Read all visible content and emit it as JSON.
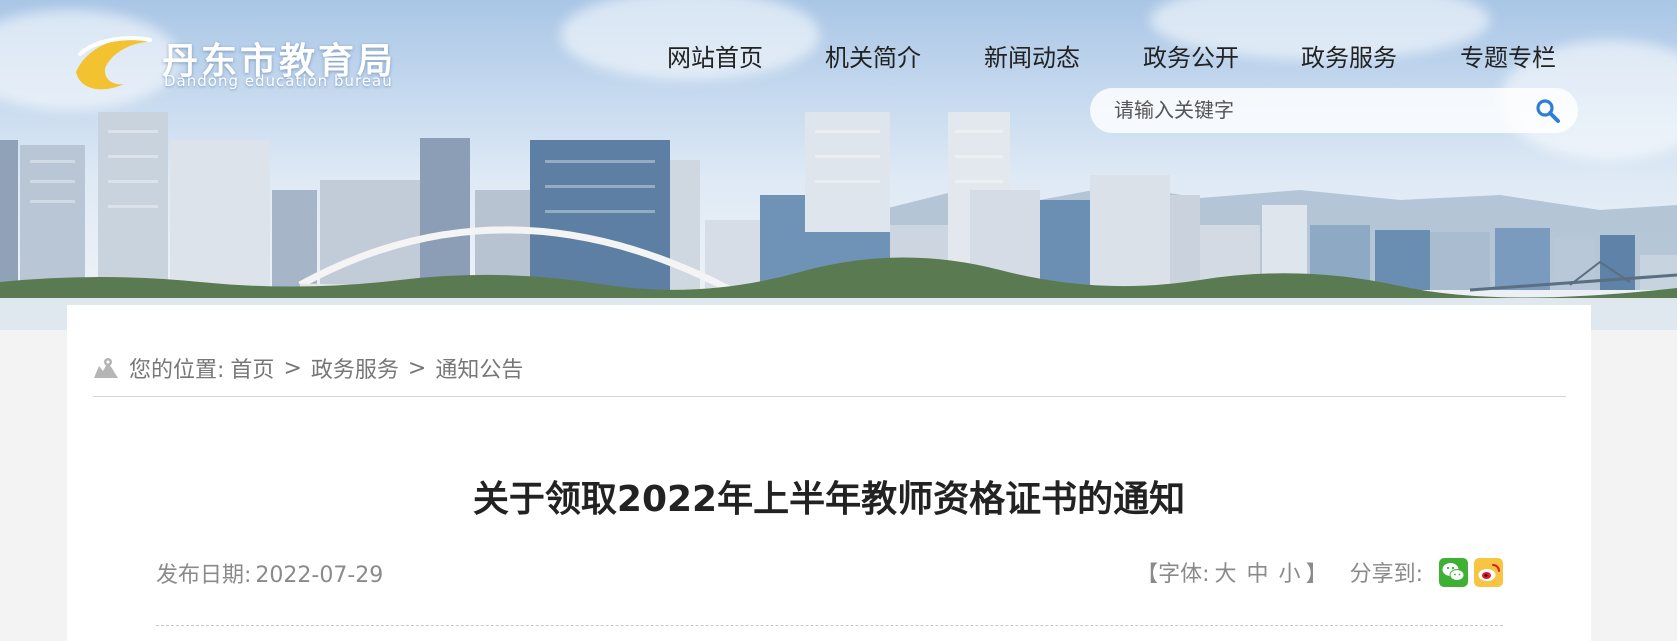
{
  "header": {
    "logo_cn": "丹东市教育局",
    "logo_en": "Dandong education bureau",
    "logo_icon": "swoosh-logo-icon",
    "nav": [
      {
        "label": "网站首页"
      },
      {
        "label": "机关简介"
      },
      {
        "label": "新闻动态"
      },
      {
        "label": "政务公开"
      },
      {
        "label": "政务服务"
      },
      {
        "label": "专题专栏"
      }
    ],
    "search": {
      "placeholder": "请输入关键字",
      "icon": "search-icon"
    }
  },
  "breadcrumb": {
    "icon": "location-map-icon",
    "prefix": "您的位置:",
    "items": [
      "首页",
      "政务服务",
      "通知公告"
    ],
    "separator": ">"
  },
  "article": {
    "title": "关于领取2022年上半年教师资格证书的通知",
    "date_label": "发布日期:",
    "date": "2022-07-29"
  },
  "tools": {
    "font_label_open": "【字体:",
    "font_sizes": [
      "大",
      "中",
      "小"
    ],
    "font_label_close": "】",
    "share_label": "分享到:",
    "share_icons": [
      "wechat-icon",
      "weibo-icon"
    ]
  },
  "colors": {
    "wechat": "#3eb135",
    "weibo": "#f6c642",
    "logo_accent": "#f2c230"
  }
}
